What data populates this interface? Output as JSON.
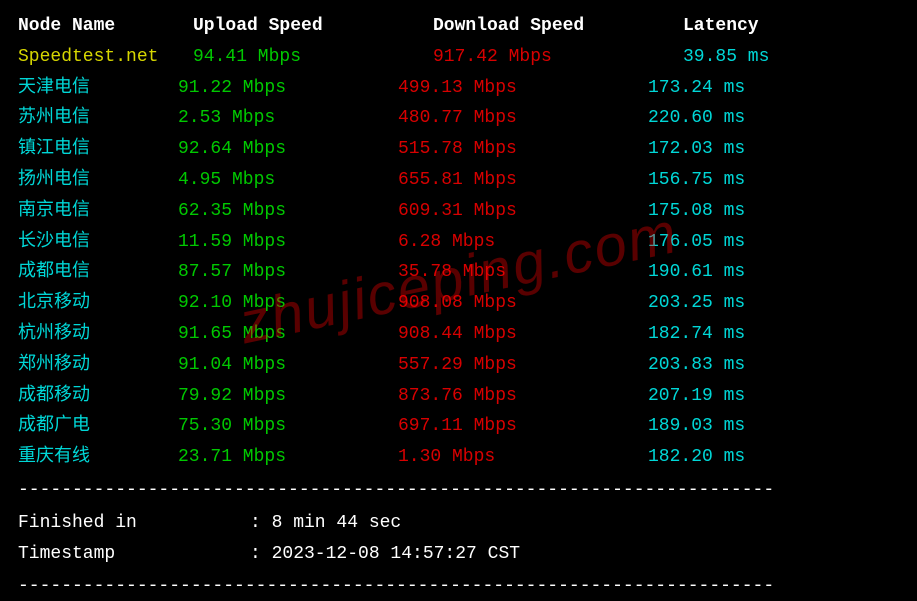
{
  "headers": {
    "node": "Node Name",
    "upload": "Upload Speed",
    "download": "Download Speed",
    "latency": "Latency"
  },
  "speedtest": {
    "node": "Speedtest.net",
    "upload": "94.41 Mbps",
    "download": "917.42 Mbps",
    "latency": "39.85 ms"
  },
  "rows": [
    {
      "node": "天津电信",
      "upload": "91.22 Mbps",
      "download": "499.13 Mbps",
      "latency": "173.24 ms"
    },
    {
      "node": "苏州电信",
      "upload": "2.53 Mbps",
      "download": "480.77 Mbps",
      "latency": "220.60 ms"
    },
    {
      "node": "镇江电信",
      "upload": "92.64 Mbps",
      "download": "515.78 Mbps",
      "latency": "172.03 ms"
    },
    {
      "node": "扬州电信",
      "upload": "4.95 Mbps",
      "download": "655.81 Mbps",
      "latency": "156.75 ms"
    },
    {
      "node": "南京电信",
      "upload": "62.35 Mbps",
      "download": "609.31 Mbps",
      "latency": "175.08 ms"
    },
    {
      "node": "长沙电信",
      "upload": "11.59 Mbps",
      "download": "6.28 Mbps",
      "latency": "176.05 ms"
    },
    {
      "node": "成都电信",
      "upload": "87.57 Mbps",
      "download": "35.78 Mbps",
      "latency": "190.61 ms"
    },
    {
      "node": "北京移动",
      "upload": "92.10 Mbps",
      "download": "908.08 Mbps",
      "latency": "203.25 ms"
    },
    {
      "node": "杭州移动",
      "upload": "91.65 Mbps",
      "download": "908.44 Mbps",
      "latency": "182.74 ms"
    },
    {
      "node": "郑州移动",
      "upload": "91.04 Mbps",
      "download": "557.29 Mbps",
      "latency": "203.83 ms"
    },
    {
      "node": "成都移动",
      "upload": "79.92 Mbps",
      "download": "873.76 Mbps",
      "latency": "207.19 ms"
    },
    {
      "node": "成都广电",
      "upload": "75.30 Mbps",
      "download": "697.11 Mbps",
      "latency": "189.03 ms"
    },
    {
      "node": "重庆有线",
      "upload": "23.71 Mbps",
      "download": "1.30 Mbps",
      "latency": "182.20 ms"
    }
  ],
  "separator": "----------------------------------------------------------------------",
  "footer": {
    "finished_label": "Finished in",
    "finished_value": ": 8 min 44 sec",
    "timestamp_label": "Timestamp",
    "timestamp_value": ": 2023-12-08 14:57:27 CST"
  },
  "watermark": "zhujiceping.com"
}
